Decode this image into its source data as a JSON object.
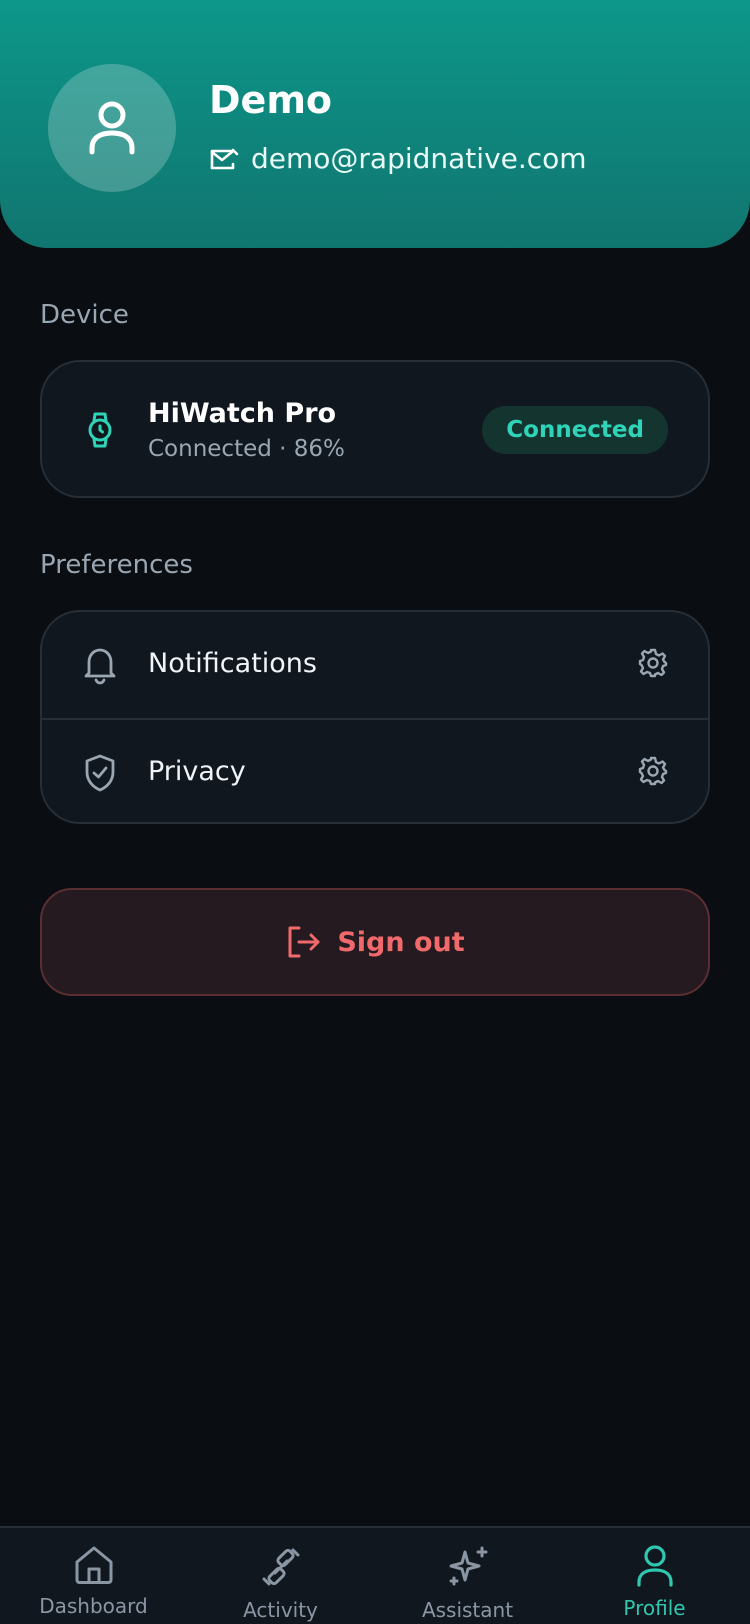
{
  "profile": {
    "name": "Demo",
    "email": "demo@rapidnative.com"
  },
  "sections": {
    "device": "Device",
    "preferences": "Preferences"
  },
  "device": {
    "name": "HiWatch Pro",
    "status": "Connected · 86%",
    "badge": "Connected"
  },
  "preferences": [
    {
      "label": "Notifications",
      "icon": "bell-icon"
    },
    {
      "label": "Privacy",
      "icon": "shield-check-icon"
    }
  ],
  "signout": {
    "label": "Sign out"
  },
  "tabs": [
    {
      "label": "Dashboard",
      "icon": "home-icon"
    },
    {
      "label": "Activity",
      "icon": "dumbbell-icon"
    },
    {
      "label": "Assistant",
      "icon": "sparkles-icon"
    },
    {
      "label": "Profile",
      "icon": "user-icon"
    }
  ],
  "active_tab": "Profile",
  "colors": {
    "accent": "#2fc7b0",
    "header_start": "#0d978a",
    "header_end": "#10756f",
    "danger": "#f0696b",
    "background": "#0a0e12"
  }
}
